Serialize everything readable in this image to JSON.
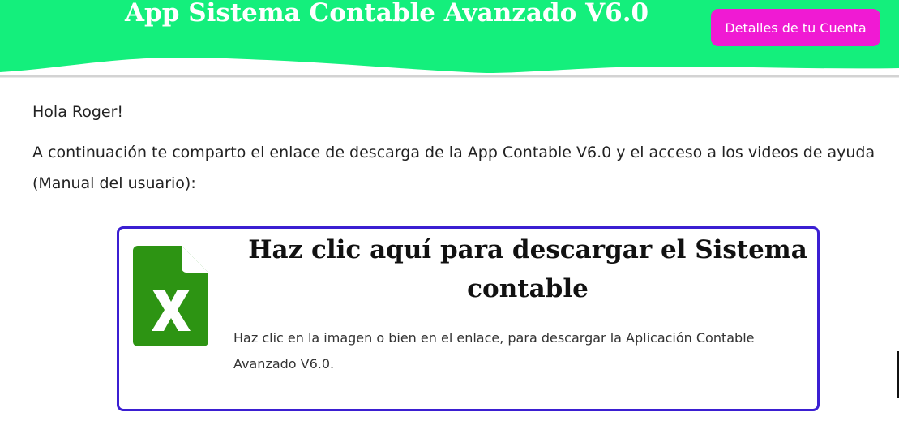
{
  "header": {
    "title": "App Sistema Contable Avanzado V6.0",
    "account_button_label": "Detalles de tu Cuenta",
    "background_color": "#14ef7c",
    "button_color": "#f01ad3"
  },
  "content": {
    "greeting": "Hola Roger!",
    "intro": "A continuación te comparto el enlace de descarga de la App Contable V6.0 y el acceso a los videos de ayuda (Manual del usuario):"
  },
  "download_card": {
    "icon": "excel-file-icon",
    "heading": "Haz clic aquí para descargar el Sistema contable",
    "description": "Haz clic en la imagen o bien en el enlace, para descargar la Aplicación Contable Avanzado V6.0.",
    "border_color": "#3b1fd2",
    "icon_color": "#2d9413"
  }
}
